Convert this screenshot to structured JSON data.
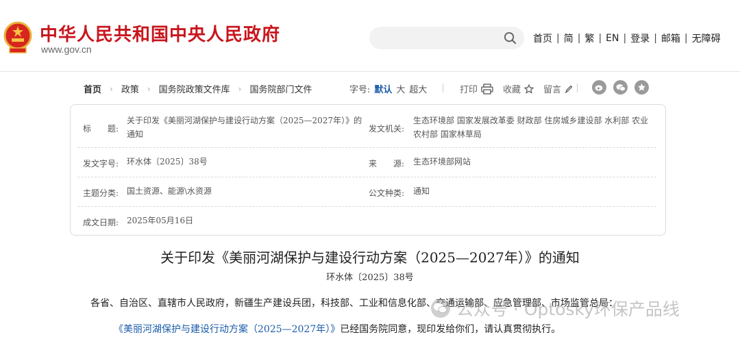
{
  "header": {
    "site_title": "中华人民共和国中央人民政府",
    "site_url": "www.gov.cn",
    "search_placeholder": "",
    "nav": [
      "首页",
      "简",
      "繁",
      "EN",
      "登录",
      "邮箱",
      "无障碍"
    ]
  },
  "breadcrumb": [
    "首页",
    "政策",
    "国务院政策文件库",
    "国务院部门文件"
  ],
  "font_size": {
    "label": "字号:",
    "options": [
      "默认",
      "大",
      "超大"
    ],
    "active": "默认"
  },
  "tools": {
    "print": "打印",
    "favorite": "收藏",
    "comment": "留言"
  },
  "share_icons": [
    "weibo-icon",
    "wechat-icon",
    "star-icon"
  ],
  "info": {
    "title_label": "标　　题:",
    "title_value": "关于印发《美丽河湖保护与建设行动方案（2025—2027年）》的通知",
    "issuer_label": "发文机关:",
    "issuer_value": "生态环境部 国家发展改革委 财政部 住房城乡建设部 水利部 农业农村部 国家林草局",
    "docno_label": "发文字号:",
    "docno_value": "环水体〔2025〕38号",
    "source_label": "来　　源:",
    "source_value": "生态环境部网站",
    "topic_label": "主题分类:",
    "topic_value": "国土资源、能源\\水资源",
    "type_label": "公文种类:",
    "type_value": "通知",
    "date_label": "成文日期:",
    "date_value": "2025年05月16日"
  },
  "article": {
    "title": "关于印发《美丽河湖保护与建设行动方案（2025—2027年）》的通知",
    "doc_number": "环水体〔2025〕38号",
    "para1": "各省、自治区、直辖市人民政府，新疆生产建设兵团，科技部、工业和信息化部、交通运输部、应急管理部、市场监管总局：",
    "para2_link": "《美丽河湖保护与建设行动方案（2025—2027年）》",
    "para2_rest": "已经国务院同意，现印发给你们，请认真贯彻执行。"
  },
  "watermark": "公众号 · Optosky环保产品线",
  "colors": {
    "brand_red": "#c8161d",
    "link_blue": "#1a5ba8"
  }
}
